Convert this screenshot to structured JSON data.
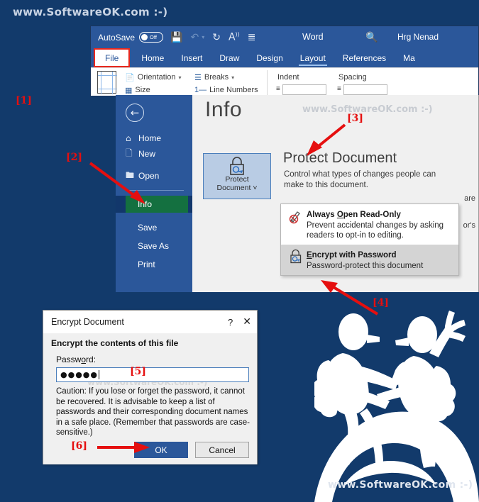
{
  "watermarks": {
    "top": "www.SoftwareOK.com  :-)",
    "bottom": "www.SoftwareOK.com  :-)",
    "backstage": "www.SoftwareOK.com  :-)",
    "dialog": "www.SoftwareOK.com  :-)"
  },
  "word": {
    "titlebar": {
      "autosave_label": "AutoSave",
      "autosave_state": "Off",
      "save_icon": "save-icon",
      "undo_icon": "undo-icon",
      "redo_icon": "redo-icon",
      "read_aloud_icon": "read-aloud-icon",
      "customize_icon": "customize-quick-access-icon",
      "app_name": "Word",
      "search_icon": "search-icon",
      "user_name": "Hrg Nenad"
    },
    "tabs": [
      {
        "label": "File",
        "state": "highlighted"
      },
      {
        "label": "Home",
        "state": "normal"
      },
      {
        "label": "Insert",
        "state": "normal"
      },
      {
        "label": "Draw",
        "state": "normal"
      },
      {
        "label": "Design",
        "state": "normal"
      },
      {
        "label": "Layout",
        "state": "active"
      },
      {
        "label": "References",
        "state": "normal"
      },
      {
        "label": "Ma",
        "state": "normal"
      }
    ],
    "ribbon": {
      "page_setup_icon": "page-setup-icon",
      "orientation": "Orientation",
      "size": "Size",
      "breaks": "Breaks",
      "line_numbers": "Line Numbers",
      "indent_label": "Indent",
      "spacing_label": "Spacing"
    }
  },
  "backstage": {
    "back_icon": "back-arrow-icon",
    "nav": [
      {
        "label": "Home",
        "icon": "home-icon"
      },
      {
        "label": "New",
        "icon": "new-document-icon"
      },
      {
        "label": "Open",
        "icon": "open-folder-icon"
      }
    ],
    "nav_selected": "Info",
    "nav_rest": [
      {
        "label": "Save"
      },
      {
        "label": "Save As"
      },
      {
        "label": "Print"
      }
    ],
    "page_title": "Info",
    "protect": {
      "tile_line1": "Protect",
      "tile_line2": "Document",
      "tile_chevron": "˅",
      "tile_icon": "lock-key-icon",
      "heading": "Protect Document",
      "description": "Control what types of changes people can make to this document."
    },
    "right_fragments": [
      "are",
      "or's"
    ],
    "menu": [
      {
        "icon": "read-only-pencil-icon",
        "title_pre": "Always ",
        "title_key": "O",
        "title_post": "pen Read-Only",
        "desc": "Prevent accidental changes by asking readers to opt-in to editing.",
        "highlighted": false
      },
      {
        "icon": "encrypt-lock-key-icon",
        "title_pre": "",
        "title_key": "E",
        "title_post": "ncrypt with Password",
        "desc": "Password-protect this document",
        "highlighted": true
      }
    ]
  },
  "dialog": {
    "title": "Encrypt Document",
    "help_icon": "help-question-icon",
    "close_icon": "close-icon",
    "heading": "Encrypt the contents of this file",
    "password_label_pre": "Passw",
    "password_label_key": "o",
    "password_label_post": "rd:",
    "password_value": "●●●●●",
    "caution": "Caution: If you lose or forget the password, it cannot be recovered. It is advisable to keep a list of passwords and their corresponding document names in a safe place.\n(Remember that passwords are case-sensitive.)",
    "ok_label": "OK",
    "cancel_label": "Cancel"
  },
  "callouts": [
    {
      "id": "1",
      "label": "[1]"
    },
    {
      "id": "2",
      "label": "[2]"
    },
    {
      "id": "3",
      "label": "[3]"
    },
    {
      "id": "4",
      "label": "[4]"
    },
    {
      "id": "5",
      "label": "[5]"
    },
    {
      "id": "6",
      "label": "[6]"
    }
  ],
  "colors": {
    "background": "#123A6B",
    "word_blue": "#2B579A",
    "callout_red": "#e50f0f",
    "selected_green": "#147040"
  }
}
